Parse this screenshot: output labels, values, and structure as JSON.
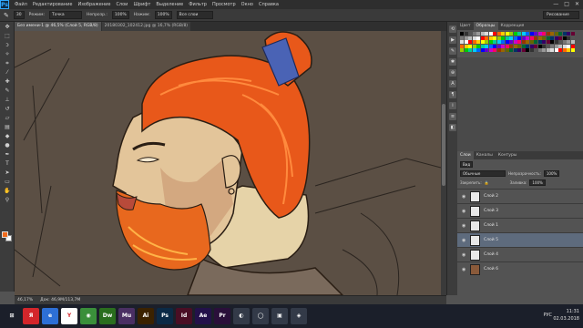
{
  "app": {
    "logo": "Ps"
  },
  "menu": [
    "Файл",
    "Редактирование",
    "Изображение",
    "Слои",
    "Шрифт",
    "Выделение",
    "Фильтр",
    "Просмотр",
    "Окно",
    "Справка"
  ],
  "window_controls": {
    "minimize": "—",
    "maximize": "□",
    "close": "✕"
  },
  "options": {
    "brush_size": "30",
    "mode_label": "Режим:",
    "mode_value": "Точка",
    "opacity_label": "Непрозр.:",
    "opacity_value": "100%",
    "flow_label": "Нажим:",
    "flow_value": "100%",
    "sample_value": "Все слои",
    "workspace": "Рисование"
  },
  "tabs": [
    {
      "label": "Без имени-1 @ 46,5% (Слой 5, RGB/8)",
      "active": true
    },
    {
      "label": "20180302_102412.jpg @ 16,7% (RGB/8)",
      "active": false
    }
  ],
  "status": {
    "zoom": "46,17%",
    "doc": "Док: 46,9M/113,7M"
  },
  "panels": {
    "swatch_tabs": [
      "Цвет",
      "Образцы",
      "Коррекция"
    ],
    "layers_tabs": [
      "Слои",
      "Каналы",
      "Контуры"
    ],
    "filter_label": "Вид",
    "blend_mode": "Обычные",
    "opacity_label": "Непрозрачность:",
    "opacity_value": "100%",
    "lock_label": "Закрепить:",
    "fill_label": "Заливка:",
    "fill_value": "100%",
    "layers": [
      {
        "name": "Слой 2",
        "active": false,
        "thumb": "light"
      },
      {
        "name": "Слой 3",
        "active": false,
        "thumb": "light"
      },
      {
        "name": "Слой 1",
        "active": false,
        "thumb": "light"
      },
      {
        "name": "Слой 5",
        "active": true,
        "thumb": "light"
      },
      {
        "name": "Слой 4",
        "active": false,
        "thumb": "light"
      },
      {
        "name": "Слой 6",
        "active": false,
        "thumb": "dark"
      }
    ]
  },
  "swatch_colors": [
    "#000000",
    "#333333",
    "#555555",
    "#777777",
    "#999999",
    "#bbbbbb",
    "#dddddd",
    "#ffffff",
    "#ff0000",
    "#ff6600",
    "#ffcc00",
    "#ffff00",
    "#99cc00",
    "#00cc00",
    "#00cc99",
    "#00ccff",
    "#0066ff",
    "#0000ff",
    "#6600cc",
    "#cc00cc",
    "#ff0066",
    "#993300",
    "#996600",
    "#666600",
    "#006633",
    "#003366",
    "#330066",
    "#660033"
  ],
  "taskbar": {
    "apps": [
      {
        "label": "⊞",
        "color": "#1b1f2a"
      },
      {
        "label": "Я",
        "color": "#d3262b"
      },
      {
        "label": "e",
        "color": "#2d6fd6"
      },
      {
        "label": "Y",
        "color": "#ffffff"
      },
      {
        "label": "◉",
        "color": "#3a8f3a"
      },
      {
        "label": "Dw",
        "color": "#2a6e1e"
      },
      {
        "label": "Mu",
        "color": "#4a2f63"
      },
      {
        "label": "Ai",
        "color": "#3b2200"
      },
      {
        "label": "Ps",
        "color": "#0b2a46"
      },
      {
        "label": "Id",
        "color": "#4a0e24"
      },
      {
        "label": "Ae",
        "color": "#23114a"
      },
      {
        "label": "Pr",
        "color": "#2a0f3a"
      },
      {
        "label": "◐",
        "color": "#333a48"
      },
      {
        "label": "◯",
        "color": "#333a48"
      },
      {
        "label": "▣",
        "color": "#333a48"
      },
      {
        "label": "◈",
        "color": "#333a48"
      }
    ],
    "lang": "РУС",
    "time": "11:31",
    "date": "02.03.2018"
  }
}
